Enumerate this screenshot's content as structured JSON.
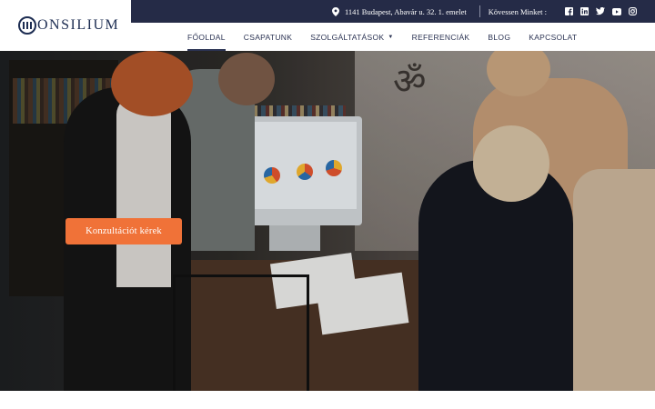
{
  "brand": {
    "logo_text": "ONSILIUM",
    "logo_icon": "column-logo-icon"
  },
  "topbar": {
    "address_icon": "map-pin-icon",
    "address": "1141 Budapest, Abavár u. 32. 1. emelet",
    "follow_label": "Kövessen Minket :",
    "social": [
      "facebook-icon",
      "linkedin-icon",
      "twitter-icon",
      "youtube-icon",
      "instagram-icon"
    ]
  },
  "nav": {
    "items": [
      {
        "label": "FŐOLDAL",
        "active": true
      },
      {
        "label": "CSAPATUNK"
      },
      {
        "label": "SZOLGÁLTATÁSOK",
        "dropdown": true
      },
      {
        "label": "REFERENCIÁK"
      },
      {
        "label": "BLOG"
      },
      {
        "label": "KAPCSOLAT"
      }
    ]
  },
  "hero": {
    "cta_label": "Konzultációt kérek",
    "accent_color": "#f07238"
  },
  "colors": {
    "topbar": "#252b47",
    "nav_text": "#2b3353"
  }
}
